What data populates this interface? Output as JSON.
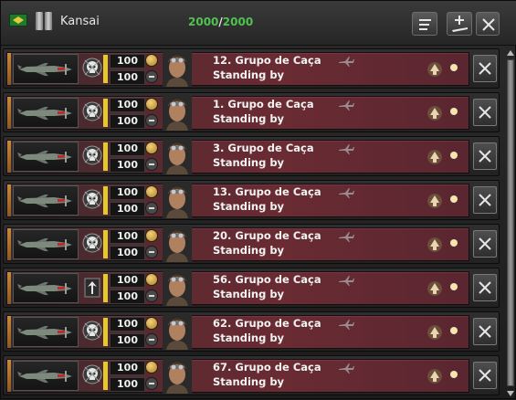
{
  "header": {
    "title": "Kansai",
    "strength_current": "2000",
    "strength_separator": "/",
    "strength_max": "2000",
    "icons": [
      "flag-icon",
      "tanks-icon"
    ],
    "buttons": [
      "sort-icon",
      "add-wing-icon",
      "close-icon"
    ]
  },
  "rows": [
    {
      "name": "12. Grupo de Caça",
      "status": "Standing by",
      "stat1": "100",
      "stat2": "100",
      "emblem": "skull-emblem-icon"
    },
    {
      "name": "1. Grupo de Caça",
      "status": "Standing by",
      "stat1": "100",
      "stat2": "100",
      "emblem": "skull-emblem-icon"
    },
    {
      "name": "3. Grupo de Caça",
      "status": "Standing by",
      "stat1": "100",
      "stat2": "100",
      "emblem": "skull-emblem-icon"
    },
    {
      "name": "13. Grupo de Caça",
      "status": "Standing by",
      "stat1": "100",
      "stat2": "100",
      "emblem": "skull-emblem-icon"
    },
    {
      "name": "20. Grupo de Caça",
      "status": "Standing by",
      "stat1": "100",
      "stat2": "100",
      "emblem": "skull-emblem-icon"
    },
    {
      "name": "56. Grupo de Caça",
      "status": "Standing by",
      "stat1": "100",
      "stat2": "100",
      "emblem": "wings-emblem-icon"
    },
    {
      "name": "62. Grupo de Caça",
      "status": "Standing by",
      "stat1": "100",
      "stat2": "100",
      "emblem": "skull-emblem-icon"
    },
    {
      "name": "67. Grupo de Caça",
      "status": "Standing by",
      "stat1": "100",
      "stat2": "100",
      "emblem": "skull-emblem-icon"
    }
  ],
  "colors": {
    "strength_text": "#4fc24f",
    "row_band": "#6a2b33",
    "strength_bar": "#e3c92e"
  }
}
